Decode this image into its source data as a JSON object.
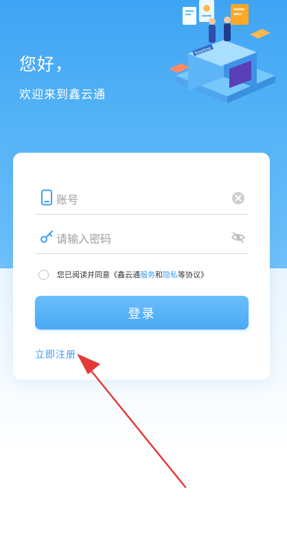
{
  "header": {
    "greeting": "您好，",
    "welcome": "欢迎来到鑫云通",
    "illustration_sign": "Totalline"
  },
  "login": {
    "account_placeholder": "账号",
    "password_placeholder": "请输入密码",
    "agreement": {
      "prefix": "您已阅读并同意《鑫云通",
      "service_link": "服务",
      "conjunction": "和",
      "privacy_link": "隐私",
      "suffix": "等协议》"
    },
    "login_button": "登录",
    "register_link": "立即注册"
  },
  "colors": {
    "hero_blue": "#3FA4F4",
    "button_blue": "#4AA9F5",
    "link_blue": "#3A9DF2",
    "annotation_arrow": "#E53935"
  },
  "icons": {
    "account": "phone-icon",
    "password": "key-icon",
    "clear": "clear-icon",
    "visibility": "eye-off-icon"
  }
}
